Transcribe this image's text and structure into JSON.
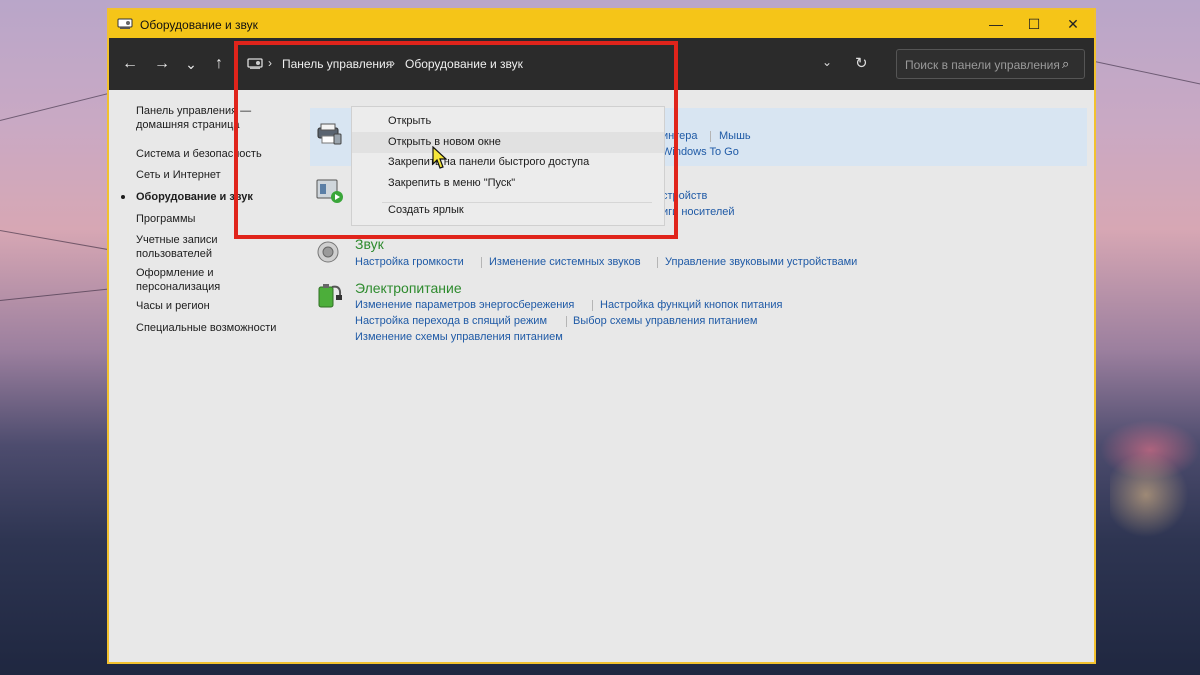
{
  "window": {
    "title": "Оборудование и звук",
    "controls": {
      "minimize": "—",
      "maximize": "☐",
      "close": "✕"
    }
  },
  "nav": {
    "back": "←",
    "forward": "→",
    "recent": "⌄",
    "up": "↑",
    "breadcrumb": [
      "Панель управления",
      "Оборудование и звук"
    ],
    "separator": "›",
    "dropdown": "⌄",
    "refresh": "↻"
  },
  "search": {
    "placeholder": "Поиск в панели управления",
    "icon": "⌕"
  },
  "left_nav": {
    "items": [
      "Панель управления — домашняя страница",
      "Система и безопасность",
      "Сеть и Интернет",
      "Оборудование и звук",
      "Программы",
      "Учетные записи пользователей",
      "Оформление и персонализация",
      "Часы и регион",
      "Специальные возможности"
    ],
    "current_index": 3
  },
  "categories": {
    "devices": {
      "links_row1": [
        "интера",
        "Мышь"
      ],
      "links_row2": [
        "Windows To Go"
      ]
    },
    "autoplay": {
      "links_row1": [
        "стройств"
      ],
      "links_row2": [
        "иги носителей"
      ]
    },
    "sound": {
      "title": "Звук",
      "links": [
        "Настройка громкости",
        "Изменение системных звуков",
        "Управление звуковыми устройствами"
      ]
    },
    "power": {
      "title": "Электропитание",
      "links_row1": [
        "Изменение параметров энергосбережения",
        "Настройка функций кнопок питания"
      ],
      "links_row2": [
        "Настройка перехода в спящий режим",
        "Выбор схемы управления питанием"
      ],
      "links_row3": [
        "Изменение схемы управления питанием"
      ]
    }
  },
  "context_menu": {
    "items": [
      "Открыть",
      "Открыть в новом окне",
      "Закрепить на панели быстрого доступа",
      "Закрепить в меню \"Пуск\"",
      "Создать ярлык"
    ],
    "hovered_index": 1
  },
  "colors": {
    "title_bar": "#f5c518",
    "nav_bar": "#2b2b2b",
    "link": "#1f5aa6",
    "category_title": "#2e8b2e",
    "highlight_box": "#e0241b"
  }
}
